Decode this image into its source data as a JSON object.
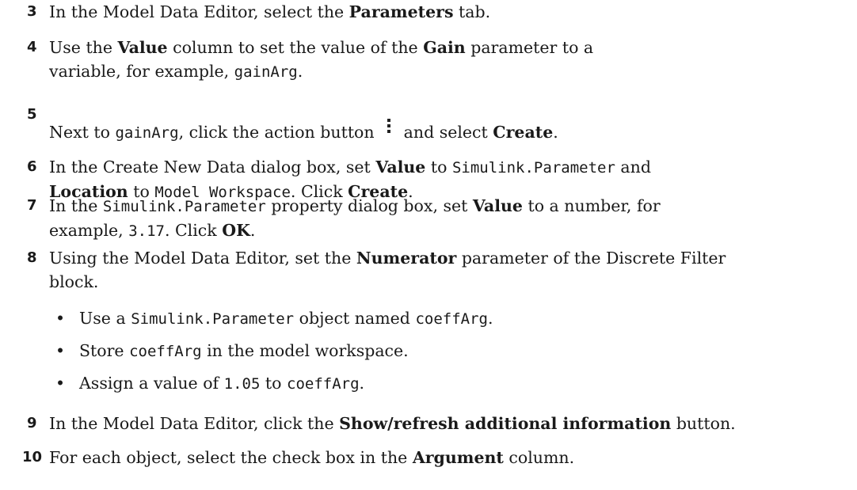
{
  "steps": [
    {
      "num": "3",
      "parts": [
        {
          "t": "In the Model Data Editor, select the "
        },
        {
          "t": "Parameters",
          "s": "b"
        },
        {
          "t": " tab."
        }
      ]
    },
    {
      "num": "4",
      "parts": [
        {
          "t": "Use the "
        },
        {
          "t": "Value",
          "s": "b"
        },
        {
          "t": " column to set the value of the "
        },
        {
          "t": "Gain",
          "s": "b"
        },
        {
          "t": " parameter to a variable, for example, "
        },
        {
          "t": "gainArg",
          "s": "c"
        },
        {
          "t": "."
        }
      ]
    },
    {
      "num": "5",
      "parts": [
        {
          "t": "Next to "
        },
        {
          "t": "gainArg",
          "s": "c"
        },
        {
          "t": ", click the action button "
        },
        {
          "s": "icon",
          "name": "kebab-menu-icon"
        },
        {
          "t": " and select "
        },
        {
          "t": "Create",
          "s": "b"
        },
        {
          "t": "."
        }
      ]
    },
    {
      "num": "6",
      "parts": [
        {
          "t": "In the Create New Data dialog box, set "
        },
        {
          "t": "Value",
          "s": "b"
        },
        {
          "t": " to "
        },
        {
          "t": "Simulink.Parameter",
          "s": "c"
        },
        {
          "t": " and "
        },
        {
          "t": "Location",
          "s": "b"
        },
        {
          "t": " to "
        },
        {
          "t": "Model Workspace",
          "s": "c"
        },
        {
          "t": ". Click "
        },
        {
          "t": "Create",
          "s": "b"
        },
        {
          "t": "."
        }
      ]
    },
    {
      "num": "7",
      "parts": [
        {
          "t": "In the "
        },
        {
          "t": "Simulink.Parameter",
          "s": "c"
        },
        {
          "t": " property dialog box, set "
        },
        {
          "t": "Value",
          "s": "b"
        },
        {
          "t": " to a number, for example, "
        },
        {
          "t": "3.17",
          "s": "c"
        },
        {
          "t": ". Click "
        },
        {
          "t": "OK",
          "s": "b"
        },
        {
          "t": "."
        }
      ]
    },
    {
      "num": "8",
      "parts": [
        {
          "t": "Using the Model Data Editor, set the "
        },
        {
          "t": "Numerator",
          "s": "b"
        },
        {
          "t": " parameter of the Discrete Filter block."
        }
      ],
      "bullets": [
        [
          {
            "t": "Use a "
          },
          {
            "t": "Simulink.Parameter",
            "s": "c"
          },
          {
            "t": " object named "
          },
          {
            "t": "coeffArg",
            "s": "c"
          },
          {
            "t": "."
          }
        ],
        [
          {
            "t": "Store "
          },
          {
            "t": "coeffArg",
            "s": "c"
          },
          {
            "t": " in the model workspace."
          }
        ],
        [
          {
            "t": "Assign a value of "
          },
          {
            "t": "1.05",
            "s": "c"
          },
          {
            "t": " to "
          },
          {
            "t": "coeffArg",
            "s": "c"
          },
          {
            "t": "."
          }
        ]
      ]
    },
    {
      "num": "9",
      "parts": [
        {
          "t": "In the Model Data Editor, click the "
        },
        {
          "t": "Show/refresh additional information",
          "s": "b"
        },
        {
          "t": " button."
        }
      ]
    },
    {
      "num": "10",
      "parts": [
        {
          "t": "For each object, select the check box in the "
        },
        {
          "t": "Argument",
          "s": "b"
        },
        {
          "t": " column."
        }
      ]
    }
  ],
  "bullet_glyph": "•"
}
